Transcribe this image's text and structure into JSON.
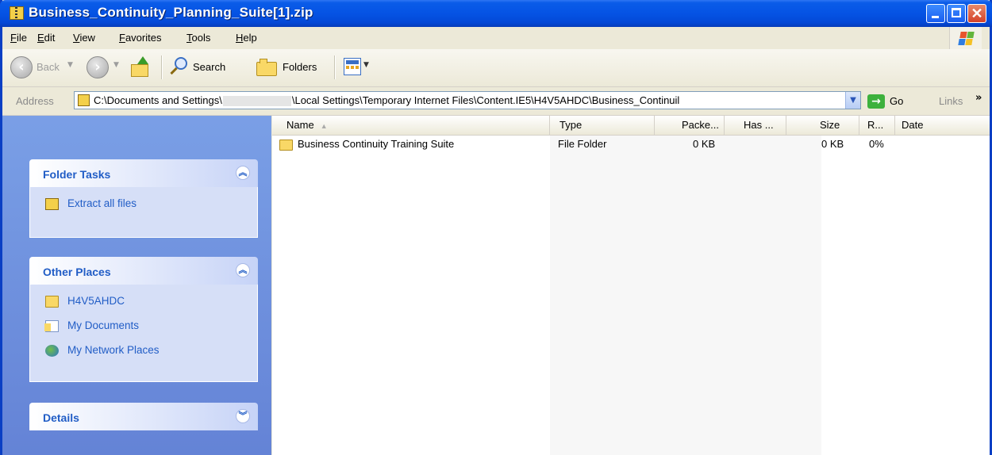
{
  "window": {
    "title": "Business_Continuity_Planning_Suite[1].zip",
    "accent": "#0a5ce8"
  },
  "menu": [
    "File",
    "Edit",
    "View",
    "Favorites",
    "Tools",
    "Help"
  ],
  "toolbar": {
    "back": "Back",
    "search": "Search",
    "folders": "Folders"
  },
  "address": {
    "label": "Address",
    "path_start": "C:\\Documents and Settings\\",
    "path_end": "\\Local Settings\\Temporary Internet Files\\Content.IE5\\H4V5AHDC\\Business_Continuil",
    "go": "Go",
    "links": "Links"
  },
  "sidebar": {
    "folder_tasks": {
      "title": "Folder Tasks",
      "items": [
        "Extract all files"
      ]
    },
    "other_places": {
      "title": "Other Places",
      "items": [
        "H4V5AHDC",
        "My Documents",
        "My Network Places"
      ]
    },
    "details": {
      "title": "Details"
    }
  },
  "list": {
    "columns": [
      "Name",
      "Type",
      "Packe...",
      "Has ...",
      "Size",
      "R...",
      "Date"
    ],
    "rows": [
      {
        "name": "Business Continuity Training Suite",
        "type": "File Folder",
        "packed": "0 KB",
        "has": "",
        "size": "0 KB",
        "ratio": "0%",
        "date": ""
      }
    ]
  }
}
